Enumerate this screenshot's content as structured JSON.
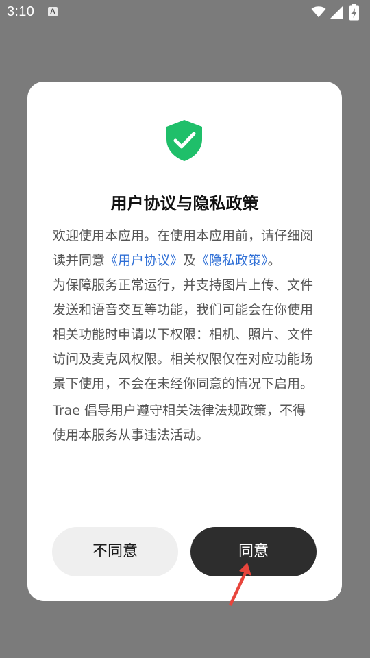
{
  "status_bar": {
    "time": "3:10",
    "notification_icon_letter": "A",
    "icons": [
      "wifi-icon",
      "signal-icon",
      "battery-charging-icon"
    ]
  },
  "dialog": {
    "icon": "shield-check-icon",
    "icon_color": "#1fbf6a",
    "title": "用户协议与隐私政策",
    "paragraph1": {
      "lead": "欢迎使用本应用。在使用本应用前，请仔细阅读并同意",
      "link1": "《用户协议》",
      "connector": "及",
      "link2": "《隐私政策》",
      "tail": "。"
    },
    "paragraph2": "为保障服务正常运行，并支持图片上传、文件发送和语音交互等功能，我们可能会在你使用相关功能时申请以下权限：相机、照片、文件访问及麦克风权限。相关权限仅在对应功能场景下使用，不会在未经你同意的情况下启用。",
    "paragraph3": "Trae 倡导用户遵守相关法律法规政策，不得使用本服务从事违法活动。",
    "link_color": "#2f6fd6"
  },
  "buttons": {
    "disagree": "不同意",
    "agree": "同意"
  },
  "annotation": {
    "arrow_color": "#e8453c"
  }
}
